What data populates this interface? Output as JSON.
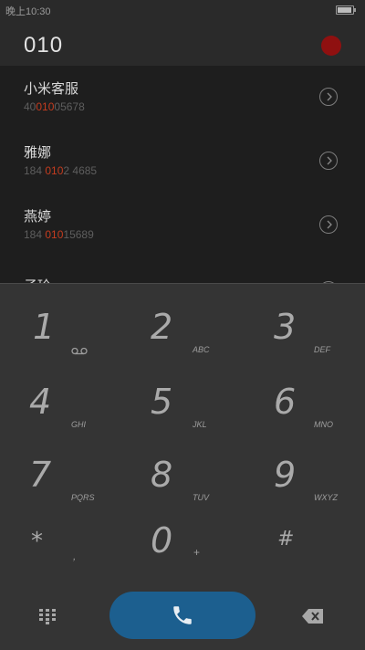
{
  "status_bar": {
    "time": "晚上10:30"
  },
  "input": {
    "text": "010"
  },
  "contacts": [
    {
      "name": "小米客服",
      "num_prefix": "40",
      "num_match": "010",
      "num_suffix": "05678"
    },
    {
      "name": "雅娜",
      "num_prefix": "184 ",
      "num_match": "010",
      "num_suffix": "2 4685"
    },
    {
      "name": "燕婷",
      "num_prefix": "184 ",
      "num_match": "010",
      "num_suffix": "15689"
    },
    {
      "name": "子玲",
      "num_prefix": "",
      "num_match": "",
      "num_suffix": ""
    }
  ],
  "dialpad": [
    {
      "digit": "1",
      "letters": "",
      "icon": "voicemail-icon"
    },
    {
      "digit": "2",
      "letters": "ABC"
    },
    {
      "digit": "3",
      "letters": "DEF"
    },
    {
      "digit": "4",
      "letters": "GHI"
    },
    {
      "digit": "5",
      "letters": "JKL"
    },
    {
      "digit": "6",
      "letters": "MNO"
    },
    {
      "digit": "7",
      "letters": "PQRS"
    },
    {
      "digit": "8",
      "letters": "TUV"
    },
    {
      "digit": "9",
      "letters": "WXYZ"
    },
    {
      "digit": "*",
      "letters": ","
    },
    {
      "digit": "0",
      "letters": "+"
    },
    {
      "digit": "#",
      "letters": ""
    }
  ],
  "colors": {
    "highlight": "#c43c1f",
    "call_button": "#1c5f8f",
    "record_dot": "#8f1010"
  }
}
